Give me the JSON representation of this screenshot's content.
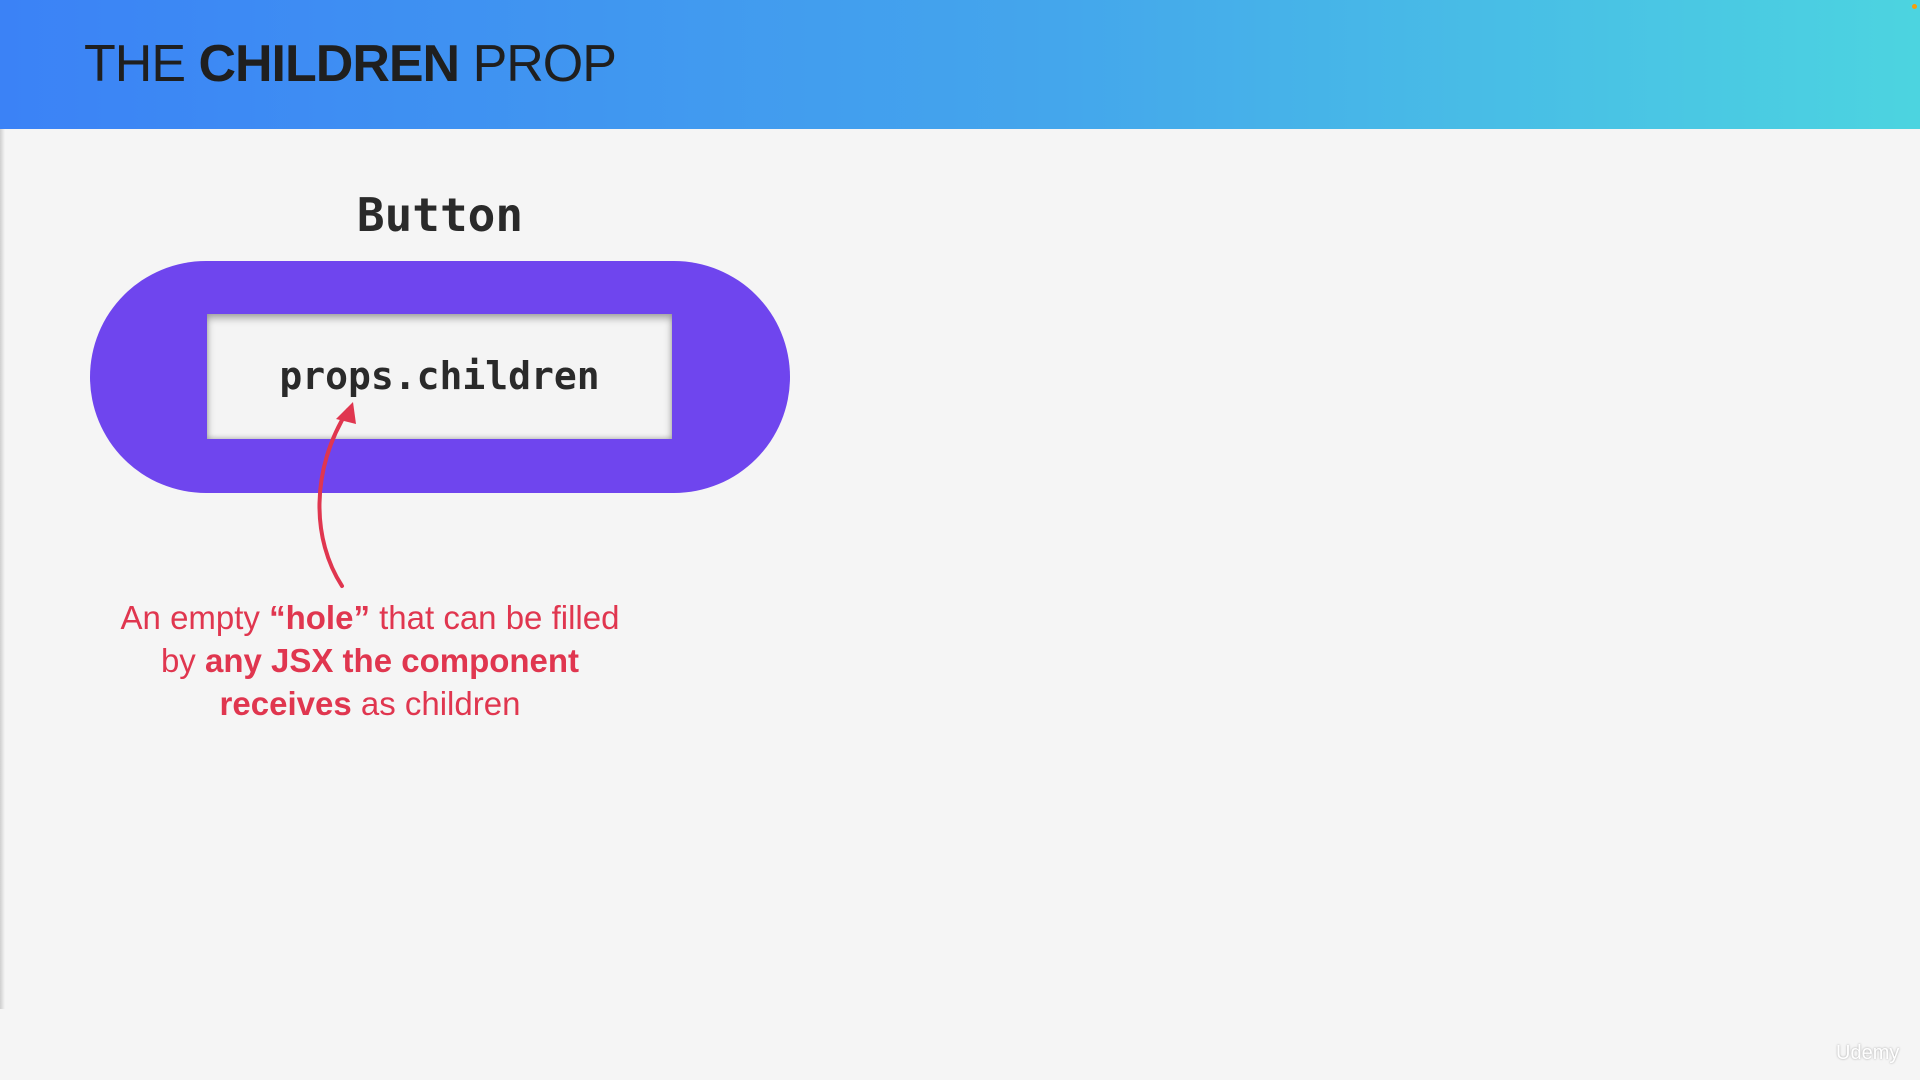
{
  "header": {
    "title_part1": "THE ",
    "title_part2": "CHILDREN",
    "title_part3": " PROP",
    "gradient_start": "#3b82f6",
    "gradient_end": "#4cd4e0"
  },
  "diagram": {
    "component_label": "Button",
    "hole_text": "props.children",
    "pill_color": "#6f45ee",
    "arrow_color": "#e0364f"
  },
  "annotation": {
    "line1_a": "An empty ",
    "line1_b": "“hole”",
    "line1_c": " that can be filled",
    "line2_a": "by ",
    "line2_b": "any JSX the component",
    "line3_b": "receives",
    "line3_c": " as children",
    "color": "#e0364f"
  },
  "watermark": "Udemy"
}
